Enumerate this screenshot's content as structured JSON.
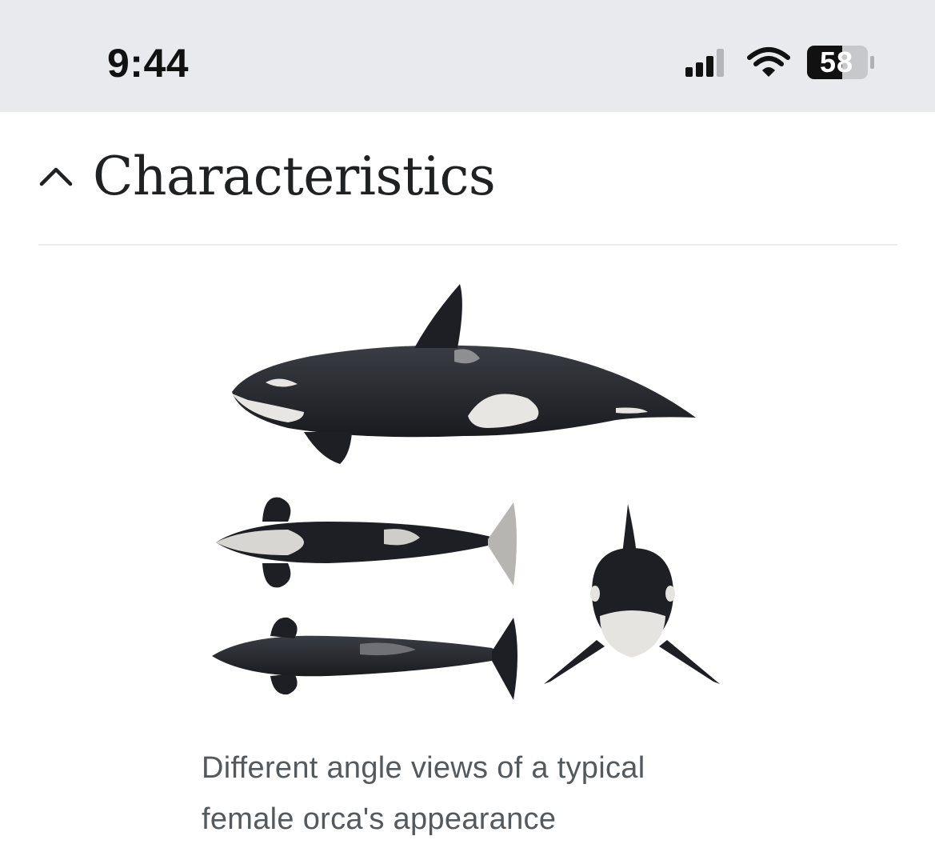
{
  "status_bar": {
    "time": "9:44",
    "battery_level": "58",
    "icons": [
      "signal-icon",
      "wifi-icon",
      "battery-icon"
    ]
  },
  "section": {
    "title": "Characteristics",
    "expanded": true,
    "icon": "chevron-up-icon"
  },
  "figure": {
    "caption": "Different angle views of a typical female orca's appearance"
  },
  "colors": {
    "status_bar_bg": "#e9eaee",
    "title_text": "#202122",
    "caption_text": "#54595d",
    "divider": "#eaecf0"
  }
}
